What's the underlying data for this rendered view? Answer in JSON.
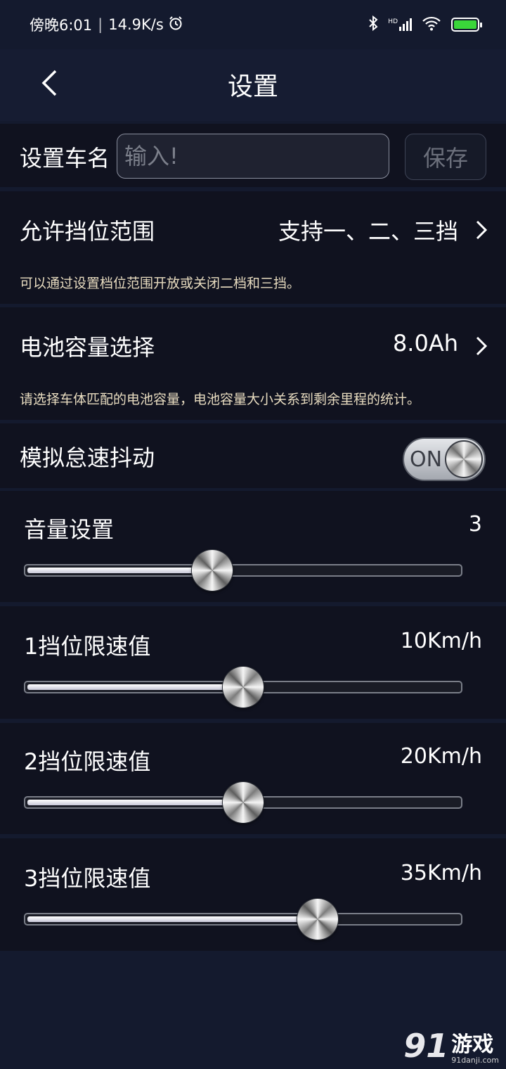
{
  "status_bar": {
    "time": "傍晚6:01",
    "speed": "14.9K/s",
    "alarm_icon": "alarm-icon",
    "bluetooth_icon": "bluetooth-icon",
    "signal_label": "HD",
    "wifi_icon": "wifi-icon",
    "battery_icon": "battery-charging-icon"
  },
  "header": {
    "title": "设置",
    "back_icon": "chevron-left-icon"
  },
  "car_name": {
    "label": "设置车名",
    "placeholder": "输入!",
    "value": "",
    "save_label": "保存"
  },
  "gear_range": {
    "label": "允许挡位范围",
    "value": "支持一、二、三挡",
    "description": "可以通过设置档位范围开放或关闭二档和三挡。"
  },
  "battery_capacity": {
    "label": "电池容量选择",
    "value": "8.0Ah",
    "description": "请选择车体匹配的电池容量，电池容量大小关系到剩余里程的统计。"
  },
  "jitter": {
    "label": "模拟怠速抖动",
    "toggle_text": "ON",
    "state": "on"
  },
  "sliders": [
    {
      "label": "音量设置",
      "value": "3",
      "fraction": 0.43
    },
    {
      "label": "1挡位限速值",
      "value": "10Km/h",
      "fraction": 0.5
    },
    {
      "label": "2挡位限速值",
      "value": "20Km/h",
      "fraction": 0.5
    },
    {
      "label": "3挡位限速值",
      "value": "35Km/h",
      "fraction": 0.67
    }
  ],
  "watermark": {
    "logo": "91",
    "text": "游戏",
    "sub": "91danji.com"
  },
  "colors": {
    "background": "#141a2e",
    "section": "#10121f",
    "description_text": "#e8dcc0"
  }
}
